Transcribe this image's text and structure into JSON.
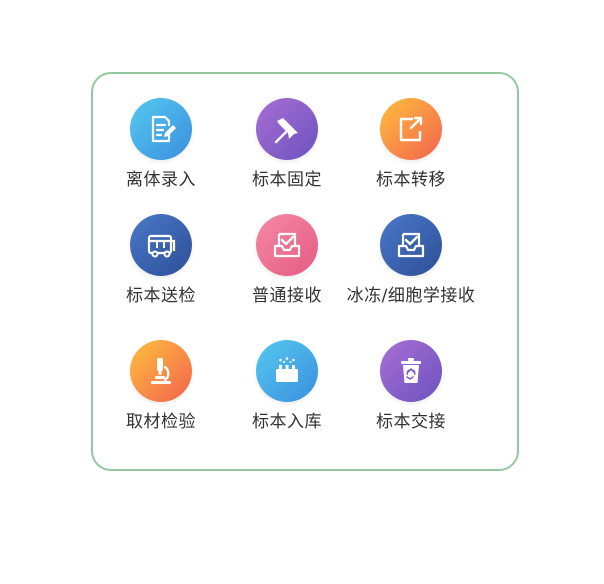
{
  "menu": {
    "items": [
      {
        "label": "离体录入",
        "icon": "document-edit-icon",
        "color_from": "#55c8f0",
        "color_to": "#3c8fde"
      },
      {
        "label": "标本固定",
        "icon": "pushpin-icon",
        "color_from": "#a86fd4",
        "color_to": "#6d52bf"
      },
      {
        "label": "标本转移",
        "icon": "transfer-export-icon",
        "color_from": "#ffbf3d",
        "color_to": "#f2624f"
      },
      {
        "label": "标本送检",
        "icon": "bus-icon",
        "color_from": "#4a78c9",
        "color_to": "#2d4f96"
      },
      {
        "label": "普通接收",
        "icon": "inbox-check-icon",
        "color_from": "#f58aa5",
        "color_to": "#e45a82"
      },
      {
        "label": "冰冻/细胞学接收",
        "icon": "inbox-check-icon",
        "color_from": "#4a78c9",
        "color_to": "#2d4f96"
      },
      {
        "label": "取材检验",
        "icon": "microscope-icon",
        "color_from": "#ffbf3d",
        "color_to": "#f2624f"
      },
      {
        "label": "标本入库",
        "icon": "specimen-rack-icon",
        "color_from": "#55c8f0",
        "color_to": "#3c8fde"
      },
      {
        "label": "标本交接",
        "icon": "recycle-bin-icon",
        "color_from": "#a86fd4",
        "color_to": "#6d52bf"
      }
    ]
  }
}
